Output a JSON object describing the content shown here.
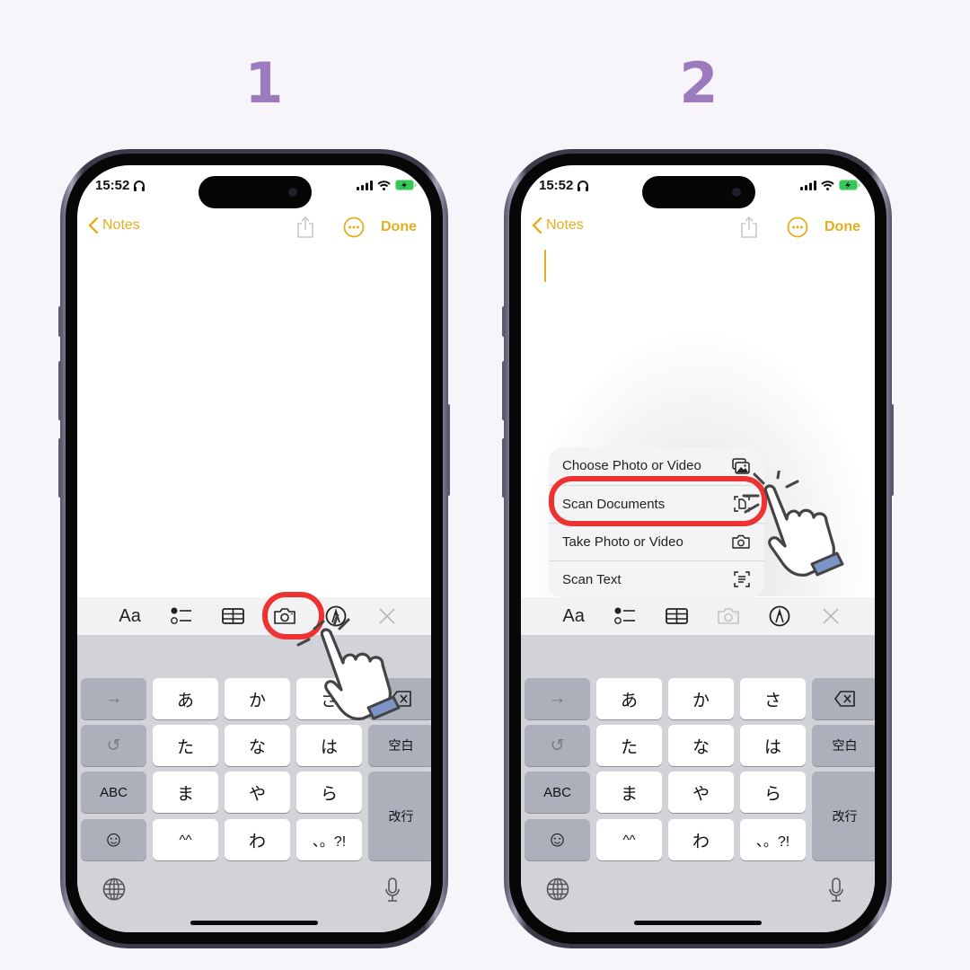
{
  "steps": [
    {
      "number": "1",
      "status": {
        "time": "15:52"
      },
      "nav": {
        "back_label": "Notes",
        "done_label": "Done"
      },
      "toolbar": {
        "format_label": "Aa",
        "camera_highlighted": true,
        "camera_dimmed": false
      },
      "note_cursor": false,
      "attachment_menu": null
    },
    {
      "number": "2",
      "status": {
        "time": "15:52"
      },
      "nav": {
        "back_label": "Notes",
        "done_label": "Done"
      },
      "toolbar": {
        "format_label": "Aa",
        "camera_highlighted": false,
        "camera_dimmed": true
      },
      "note_cursor": true,
      "attachment_menu": {
        "items": [
          {
            "label": "Choose Photo or Video",
            "icon": "photo-library-icon"
          },
          {
            "label": "Scan Documents",
            "icon": "scan-document-icon",
            "highlighted": true
          },
          {
            "label": "Take Photo or Video",
            "icon": "camera-icon"
          },
          {
            "label": "Scan Text",
            "icon": "scan-text-icon"
          }
        ]
      }
    }
  ],
  "keyboard": {
    "left_keys": [
      "→",
      "↺",
      "ABC",
      "☺"
    ],
    "kana_rows": [
      [
        "あ",
        "か",
        "さ"
      ],
      [
        "た",
        "な",
        "は"
      ],
      [
        "ま",
        "や",
        "ら"
      ],
      [
        "^^",
        "わ",
        "、。?!"
      ]
    ],
    "space_label": "空白",
    "return_label": "改行"
  },
  "colors": {
    "accent": "#e4ae1d",
    "step_number": "#9b7abd",
    "highlight": "#ee3131",
    "background": "#f7f5f9"
  }
}
